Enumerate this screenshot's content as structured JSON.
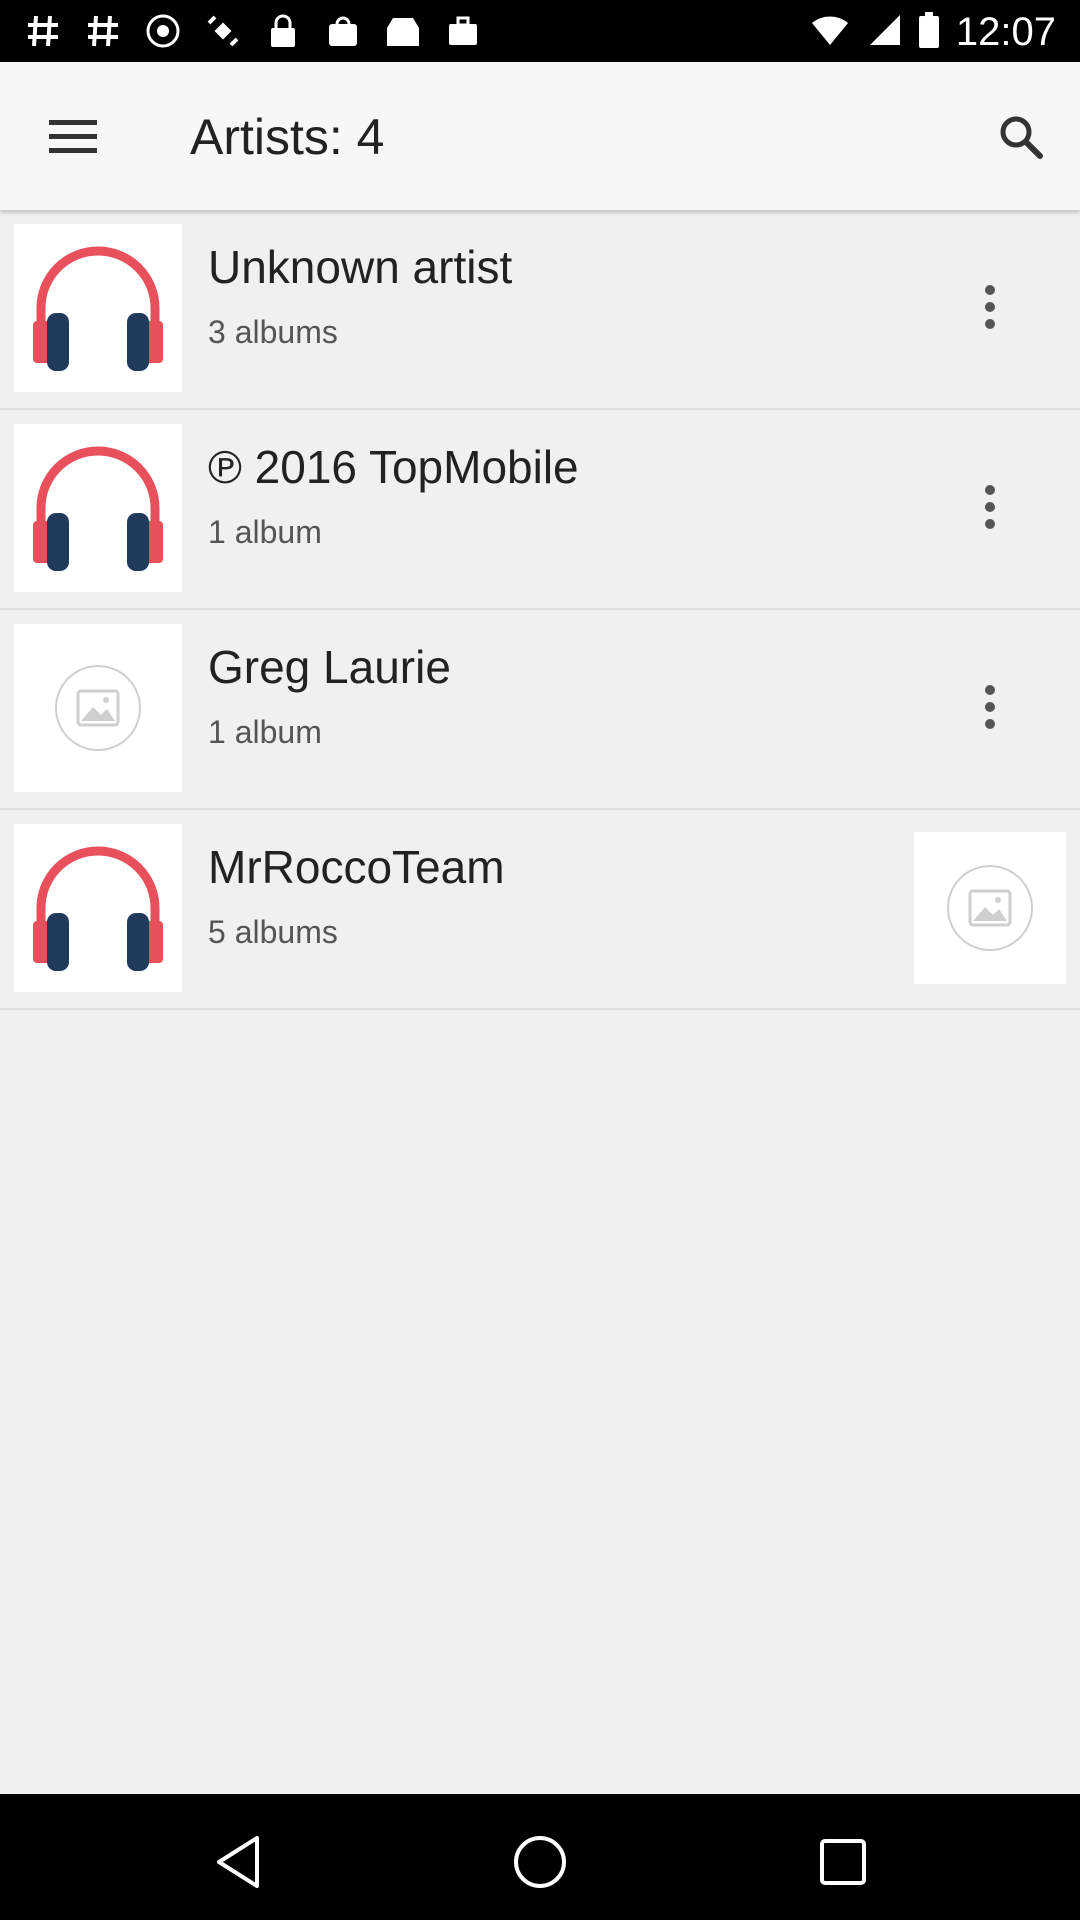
{
  "status_bar": {
    "time": "12:07",
    "icons": [
      "hash-icon",
      "hash-icon",
      "vpn-icon",
      "satellite-icon",
      "lock-icon",
      "shopping-bag-icon",
      "inbox-icon",
      "briefcase-icon",
      "wifi-icon",
      "signal-icon",
      "battery-icon"
    ]
  },
  "app_bar": {
    "title": "Artists: 4",
    "menu_icon": "menu-icon",
    "search_icon": "search-icon"
  },
  "artists": [
    {
      "name": "Unknown artist",
      "count": "3 albums",
      "thumb": "headphones-icon",
      "action": "more-vert-icon"
    },
    {
      "name": "℗ 2016 TopMobile",
      "count": "1 album",
      "thumb": "headphones-icon",
      "action": "more-vert-icon"
    },
    {
      "name": "Greg Laurie",
      "count": "1 album",
      "thumb": "image-placeholder-icon",
      "action": "more-vert-icon"
    },
    {
      "name": "MrRoccoTeam",
      "count": "5 albums",
      "thumb": "headphones-icon",
      "action": "image-placeholder-icon"
    }
  ],
  "colors": {
    "headphone_red": "#e8505b",
    "headphone_navy": "#1f3a5a",
    "background": "#f0f0f0",
    "appbar": "#f7f7f7"
  },
  "nav_bar": {
    "buttons": [
      "back-icon",
      "home-icon",
      "recents-icon"
    ]
  }
}
